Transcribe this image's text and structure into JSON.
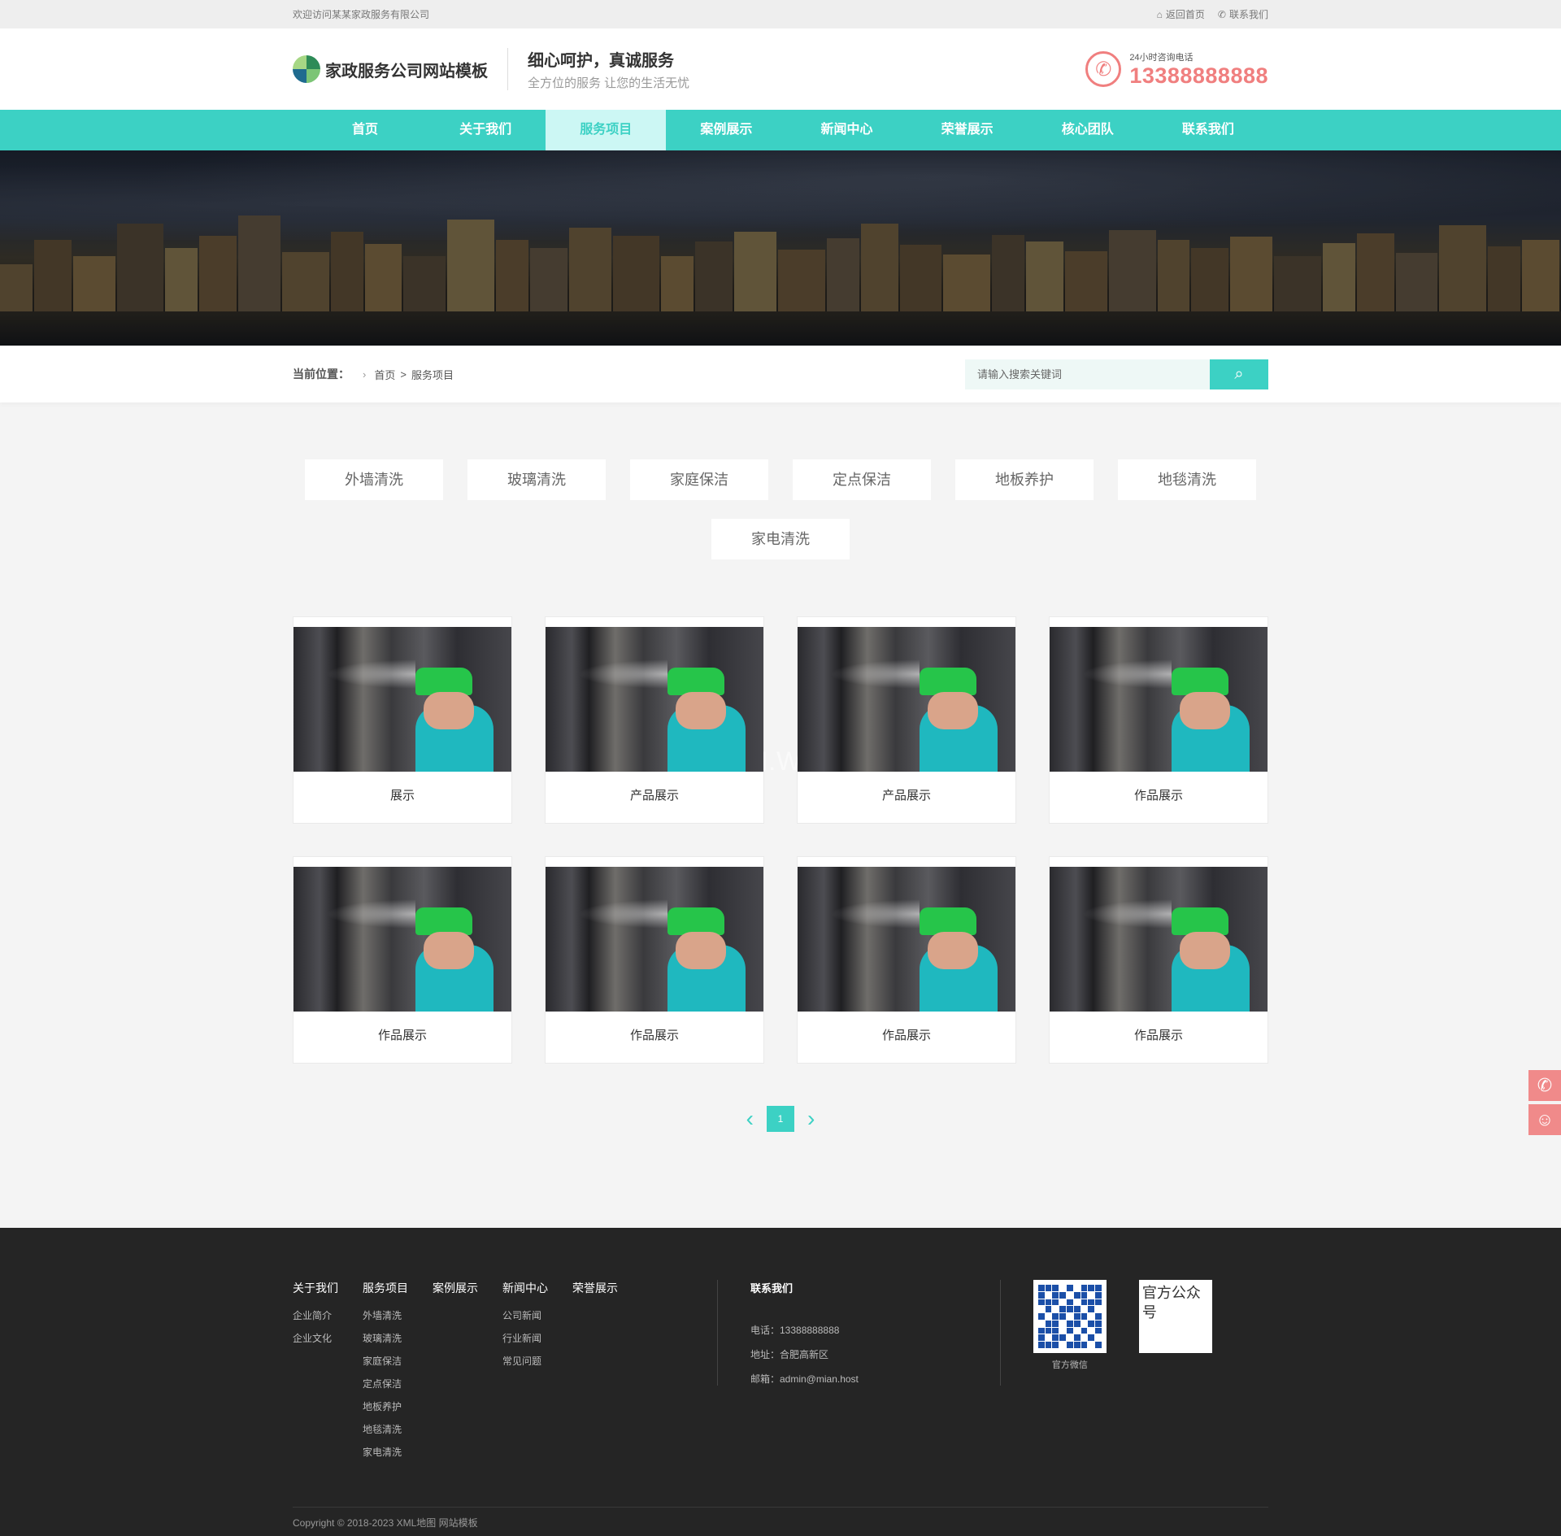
{
  "topbar": {
    "welcome": "欢迎访问某某家政服务有限公司",
    "home_link": "返回首页",
    "contact_link": "联系我们"
  },
  "header": {
    "logo_text": "家政服务公司网站模板",
    "slogan_main": "细心呵护，真诚服务",
    "slogan_sub": "全方位的服务 让您的生活无忧",
    "hotline_label": "24小时咨询电话",
    "hotline_number": "13388888888"
  },
  "nav": {
    "items": [
      "首页",
      "关于我们",
      "服务项目",
      "案例展示",
      "新闻中心",
      "荣誉展示",
      "核心团队",
      "联系我们"
    ],
    "active": "服务项目"
  },
  "location": {
    "label": "当前位置：",
    "home": "首页",
    "sep": ">",
    "current": "服务项目",
    "search_placeholder": "请输入搜索关键词"
  },
  "categories": [
    "外墙清洗",
    "玻璃清洗",
    "家庭保洁",
    "定点保洁",
    "地板养护",
    "地毯清洗",
    "家电清洗"
  ],
  "products": [
    {
      "label": "展示"
    },
    {
      "label": "产品展示"
    },
    {
      "label": "产品展示"
    },
    {
      "label": "作品展示"
    },
    {
      "label": "作品展示"
    },
    {
      "label": "作品展示"
    },
    {
      "label": "作品展示"
    },
    {
      "label": "作品展示"
    }
  ],
  "watermark": "MIAN.WORK",
  "pagination": {
    "current": "1"
  },
  "footer": {
    "columns": [
      {
        "title": "关于我们",
        "items": [
          "企业简介",
          "企业文化"
        ]
      },
      {
        "title": "服务项目",
        "items": [
          "外墙清洗",
          "玻璃清洗",
          "家庭保洁",
          "定点保洁",
          "地板养护",
          "地毯清洗",
          "家电清洗"
        ]
      },
      {
        "title": "案例展示",
        "items": []
      },
      {
        "title": "新闻中心",
        "items": [
          "公司新闻",
          "行业新闻",
          "常见问题"
        ]
      },
      {
        "title": "荣誉展示",
        "items": []
      }
    ],
    "contact_title": "联系我们",
    "phone": "电话：13388888888",
    "address": "地址：合肥高新区",
    "email": "邮箱：admin@mian.host",
    "wechat_caption": "官方微信",
    "official_alt": "官方公众号",
    "copyright": "Copyright © 2018-2023 XML地图 网站模板"
  },
  "colors": {
    "accent": "#3cd1c4",
    "hotline": "#f07f7f",
    "footer_bg": "#252525"
  },
  "icons": [
    "home-icon",
    "phone-icon",
    "search-icon",
    "chevron-left-icon",
    "chevron-right-icon",
    "wechat-icon"
  ]
}
